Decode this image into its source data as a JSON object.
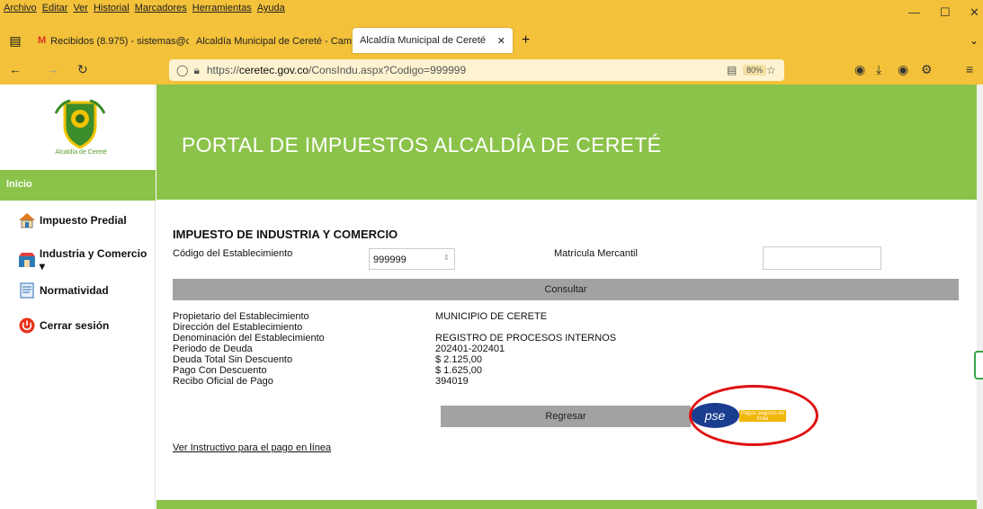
{
  "menu": [
    "Archivo",
    "Editar",
    "Ver",
    "Historial",
    "Marcadores",
    "Herramientas",
    "Ayuda"
  ],
  "tabs": [
    {
      "label": "Recibidos (8.975) - sistemas@c● ✕"
    },
    {
      "label": "Alcaldía Municipal de Cereté - Cam ✕"
    },
    {
      "label": "Alcaldía Municipal de Cereté"
    }
  ],
  "url": {
    "prefix": "https://",
    "domain": "ceretec.gov.co",
    "path": "/ConsIndu.aspx?Codigo=999999"
  },
  "zoom": "80%",
  "sidebar": {
    "logo_text": "Alcaldía de Cereté",
    "home": "Inicio",
    "items": [
      "Impuesto Predial",
      "Industria y Comercio ▾",
      "Normatividad",
      "Cerrar sesión"
    ]
  },
  "banner_title": "PORTAL DE IMPUESTOS ALCALDÍA DE CERETÉ",
  "form": {
    "title": "IMPUESTO DE INDUSTRIA Y COMERCIO",
    "code_label": "Código del Establecimiento",
    "code_value": "999999",
    "matricula_label": "Matrícula Mercantil",
    "matricula_value": "",
    "consult_label": "Consultar"
  },
  "details": [
    {
      "label": "Propietario del Establecimiento",
      "value": "MUNICIPIO DE CERETE"
    },
    {
      "label": "Dirección del Establecimiento",
      "value": ""
    },
    {
      "label": "Denominación del Establecimiento",
      "value": "REGISTRO DE PROCESOS INTERNOS"
    },
    {
      "label": "Periodo de Deuda",
      "value": "202401-202401"
    },
    {
      "label": "Deuda Total Sin Descuento",
      "value": "$ 2.125,00"
    },
    {
      "label": "Pago Con Descuento",
      "value": "$ 1.625,00"
    },
    {
      "label": "Recibo Oficial de Pago",
      "value": "394019"
    }
  ],
  "back_label": "Regresar",
  "pse": {
    "logo": "pse",
    "tagline": "Pagos seguros en línea"
  },
  "instructions_link": "Ver Instructivo para el pago en línea",
  "colors": {
    "browser_bar": "#f3c23a",
    "brand_green": "#8bc34a",
    "button_gray": "#a2a2a2",
    "highlight_red": "#e01010",
    "pse_blue": "#1a3d8f",
    "pse_yellow": "#f2b705"
  }
}
